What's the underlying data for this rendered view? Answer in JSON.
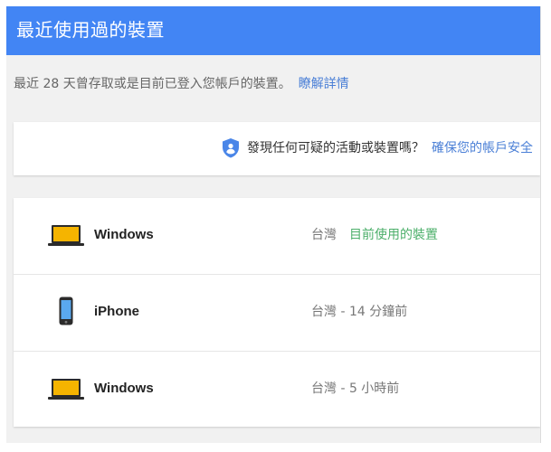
{
  "header": {
    "title": "最近使用過的裝置"
  },
  "description": {
    "text": "最近 28 天曾存取或是目前已登入您帳戶的裝置。",
    "link": "瞭解詳情"
  },
  "security": {
    "icon": "shield-icon",
    "question": "發現任何可疑的活動或裝置嗎？",
    "link": "確保您的帳戶安全"
  },
  "devices": [
    {
      "icon": "laptop-icon",
      "name": "Windows",
      "location": "台灣",
      "status": "目前使用的裝置"
    },
    {
      "icon": "phone-icon",
      "name": "iPhone",
      "location_time": "台灣 - 14 分鐘前"
    },
    {
      "icon": "laptop-icon",
      "name": "Windows",
      "location_time": "台灣 - 5 小時前"
    }
  ],
  "colors": {
    "header": "#4285f4",
    "link": "#4a7fd6",
    "current_device": "#4caf6a",
    "shield": "#4a86e8",
    "laptop_screen": "#f5b400"
  }
}
